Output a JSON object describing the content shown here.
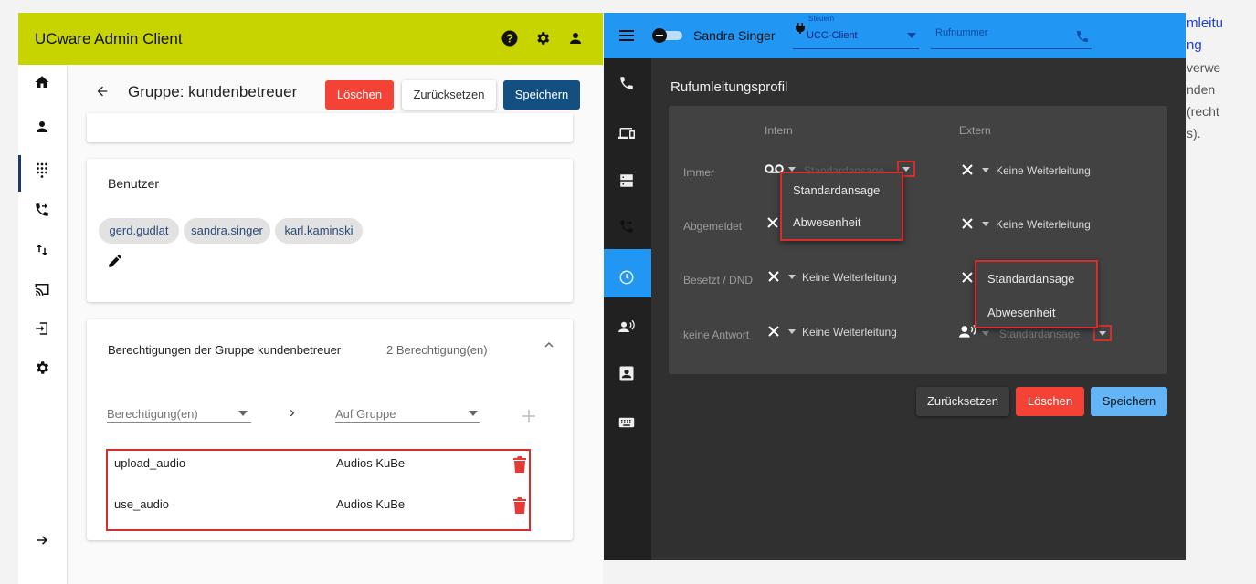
{
  "admin": {
    "title": "UCware Admin Client",
    "header_label": "Gruppe: kundenbetreuer",
    "delete_label": "Löschen",
    "reset_label": "Zurücksetzen",
    "save_label": "Speichern",
    "users_card": {
      "title": "Benutzer",
      "chips": [
        "gerd.gudlat",
        "sandra.singer",
        "karl.kaminski"
      ]
    },
    "permissions_card": {
      "title": "Berechtigungen der Gruppe kundenbetreuer",
      "count": "2 Berechtigung(en)",
      "perm_select_placeholder": "Berechtigung(en)",
      "group_select_placeholder": "Auf Gruppe",
      "arrow": "›",
      "rows": [
        {
          "permission": "upload_audio",
          "group": "Audios KuBe"
        },
        {
          "permission": "use_audio",
          "group": "Audios KuBe"
        }
      ]
    }
  },
  "ucc": {
    "user_name": "Sandra Singer",
    "control_label": "Steuern",
    "control_value": "UCC-Client",
    "phone_placeholder": "Rufnummer",
    "panel_title": "Rufumleitungsprofil",
    "col_intern": "Intern",
    "col_extern": "Extern",
    "rows": [
      {
        "label": "Immer",
        "intern": "Standardansage",
        "extern": "Keine Weiterleitung"
      },
      {
        "label": "Abgemeldet",
        "intern": "",
        "extern": "Keine Weiterleitung"
      },
      {
        "label": "Besetzt / DND",
        "intern": "Keine Weiterleitung",
        "extern": ""
      },
      {
        "label": "keine Antwort",
        "intern": "Keine Weiterleitung",
        "extern": "Standardansage"
      }
    ],
    "menu1": [
      "Standardansage",
      "Abwesenheit"
    ],
    "menu2": [
      "Standardansage",
      "Abwesenheit"
    ],
    "reset_label": "Zurücksetzen",
    "delete_label": "Löschen",
    "save_label": "Speichern"
  },
  "sidebar_text": {
    "link_line1": "mleitu",
    "link_line2": "ng",
    "lines": [
      "verwe",
      "nden",
      "(recht",
      "s)."
    ]
  },
  "colors": {
    "admin_header": "#c8d400",
    "primary_dark": "#134f80",
    "danger": "#f44336",
    "ucc_blue": "#2196f3",
    "ucc_save": "#64b5f6"
  }
}
